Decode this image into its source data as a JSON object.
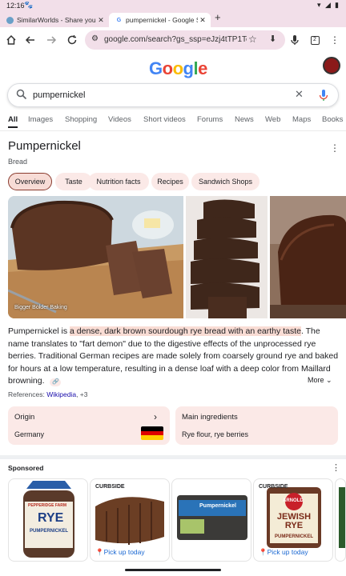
{
  "status": {
    "time": "12:16"
  },
  "tabs": [
    {
      "title": "SimilarWorlds - Share your"
    },
    {
      "title": "pumpernickel - Google Se"
    }
  ],
  "toolbar": {
    "url": "google.com/search?gs_ssp=eJzj4tTP1TcwT"
  },
  "google": {
    "logo_letters": [
      "G",
      "o",
      "o",
      "g",
      "l",
      "e"
    ]
  },
  "search": {
    "query": "pumpernickel"
  },
  "nav_tabs": [
    "All",
    "Images",
    "Shopping",
    "Videos",
    "Short videos",
    "Forums",
    "News",
    "Web",
    "Maps",
    "Books"
  ],
  "knowledge_panel": {
    "title": "Pumpernickel",
    "subtitle": "Bread",
    "chips": [
      "Overview",
      "Taste",
      "Nutrition facts",
      "Recipes",
      "Sandwich Shops"
    ],
    "image_caption": "Bigger Bolder Baking",
    "description_pre": "Pumpernickel is ",
    "description_highlight": "a dense, dark brown sourdough rye bread with an earthy taste",
    "description_post": ". The name translates to \"fart demon\" due to the digestive effects of the unprocessed rye berries. Traditional German recipes are made solely from coarsely ground rye and baked for hours at a low temperature, resulting in a dense loaf with a deep color from Maillard browning.",
    "more_label": "More",
    "references_label": "References: ",
    "references_link": "Wikipedia",
    "references_count": ", +3",
    "origin_label": "Origin",
    "origin_value": "Germany",
    "ingredients_label": "Main ingredients",
    "ingredients_value": "Rye flour, rye berries"
  },
  "sponsored": {
    "label": "Sponsored",
    "products": [
      {
        "badge": "",
        "pickup": "",
        "brand": "PEPPERIDGE FARM",
        "name": "RYE",
        "variant": "PUMPERNICKEL"
      },
      {
        "badge": "CURBSIDE",
        "pickup": "Pick up today"
      },
      {
        "badge": "",
        "pickup": "",
        "name": "Pumpernickel"
      },
      {
        "badge": "CURBSIDE",
        "pickup": "Pick up today",
        "brand": "ARNOLD",
        "name": "JEWISH RYE",
        "variant": "PUMPERNICKEL"
      }
    ]
  },
  "colors": {
    "chrome_pink": "#f2dfe9",
    "chip_bg": "#fbe9e7",
    "highlight": "#f9dcd4",
    "link_blue": "#1a0dab",
    "google_blue": "#4285f4",
    "google_red": "#ea4335",
    "google_yellow": "#fbbc05",
    "google_green": "#34a853"
  }
}
